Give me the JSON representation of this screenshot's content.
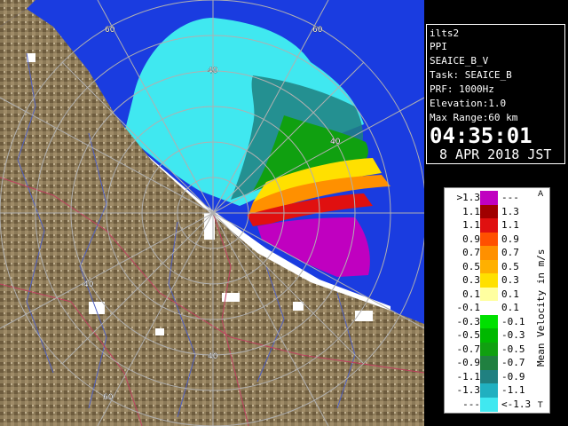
{
  "info": {
    "station": "ilts2",
    "scan_type": "PPI",
    "product": "SEAICE_B_V",
    "task": "Task: SEAICE_B",
    "prf": "PRF: 1000Hz",
    "elevation": "Elevation:1.0",
    "max_range": "Max Range:60 km",
    "time": "04:35:01",
    "date": "8 APR 2018 JST"
  },
  "range_labels": {
    "r60_top": "60",
    "r40_top": "40",
    "r40_right": "40",
    "r60_right": "60",
    "r40_left": "40",
    "r40_bottom": "40",
    "r60_bottom": "60"
  },
  "legend": {
    "title": "Mean Velocity in m/s",
    "tick_top": "A",
    "tick_bottom": "T",
    "rows": [
      {
        "left": ">1.3",
        "right": "---",
        "color": "#c000c0"
      },
      {
        "left": "1.1",
        "right": "1.3",
        "color": "#a00000"
      },
      {
        "left": "1.1",
        "right": "1.1",
        "color": "#e01010"
      },
      {
        "left": "0.9",
        "right": "0.9",
        "color": "#ff5000"
      },
      {
        "left": "0.7",
        "right": "0.7",
        "color": "#ff9000"
      },
      {
        "left": "0.5",
        "right": "0.5",
        "color": "#ffb000"
      },
      {
        "left": "0.3",
        "right": "0.3",
        "color": "#ffe000"
      },
      {
        "left": "0.1",
        "right": "0.1",
        "color": "#ffffa0"
      },
      {
        "left": "-0.1",
        "right": "0.1",
        "color": "#ffffff"
      },
      {
        "left": "-0.3",
        "right": "-0.1",
        "color": "#00e000"
      },
      {
        "left": "-0.5",
        "right": "-0.3",
        "color": "#00b800"
      },
      {
        "left": "-0.7",
        "right": "-0.5",
        "color": "#10a010"
      },
      {
        "left": "-0.9",
        "right": "-0.7",
        "color": "#208040"
      },
      {
        "left": "-1.1",
        "right": "-0.9",
        "color": "#208080"
      },
      {
        "left": "-1.3",
        "right": "-1.1",
        "color": "#20b0c0"
      },
      {
        "left": "---",
        "right": "<-1.3",
        "color": "#40e8f0"
      }
    ]
  },
  "colors": {
    "sea": "#1a3ce0",
    "land": "#8a7a5a",
    "range_ring": "#b0b0b0"
  }
}
